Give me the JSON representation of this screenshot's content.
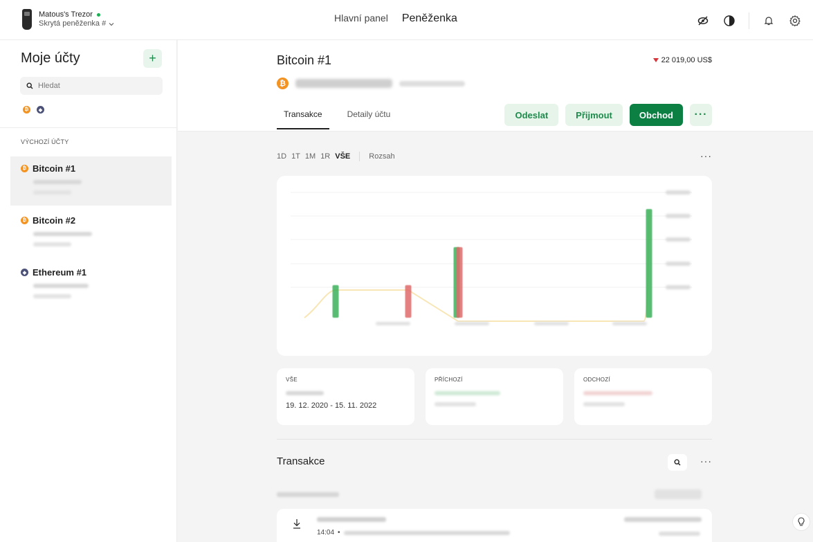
{
  "device": {
    "name": "Matous's Trezor",
    "wallet": "Skrytá peněženka #"
  },
  "nav": {
    "dashboard": "Hlavní panel",
    "wallet": "Peněženka"
  },
  "sidebar": {
    "title": "Moje účty",
    "add_label": "+",
    "search_placeholder": "Hledat",
    "section_label": "VÝCHOZÍ ÚČTY",
    "accounts": [
      {
        "name": "Bitcoin #1",
        "coin": "btc",
        "active": true
      },
      {
        "name": "Bitcoin #2",
        "coin": "btc",
        "active": false
      },
      {
        "name": "Ethereum #1",
        "coin": "eth",
        "active": false
      }
    ]
  },
  "account": {
    "title": "Bitcoin #1",
    "price_change": "22 019,00 US$",
    "price_direction": "down"
  },
  "tabs": {
    "transactions": "Transakce",
    "details": "Detaily účtu"
  },
  "actions": {
    "send": "Odeslat",
    "receive": "Přijmout",
    "trade": "Obchod",
    "more": "···"
  },
  "ranges": {
    "items": [
      "1D",
      "1T",
      "1M",
      "1R",
      "VŠE"
    ],
    "active": "VŠE",
    "custom": "Rozsah",
    "more": "···"
  },
  "chart_data": {
    "type": "bar",
    "title": "",
    "xlabel": "",
    "ylabel": "",
    "series": [
      {
        "color": "#3cb25b",
        "values": [
          0.3,
          0,
          0.65,
          0,
          0,
          1.0
        ]
      },
      {
        "color": "#e06a6a",
        "values": [
          0,
          0.3,
          0.65,
          0,
          0,
          0
        ]
      }
    ],
    "categories": [
      "",
      "",
      "",
      "",
      "",
      ""
    ],
    "line_color": "#f2d27a"
  },
  "stats": {
    "all": {
      "label": "VŠE",
      "range": "19. 12. 2020 - 15. 11. 2022"
    },
    "incoming": {
      "label": "PŘÍCHOZÍ"
    },
    "outgoing": {
      "label": "ODCHOZÍ"
    }
  },
  "transactions": {
    "title": "Transakce",
    "more": "···",
    "rows": [
      {
        "time": "14:04",
        "separator": "•"
      }
    ]
  },
  "colors": {
    "accent": "#0c7f43",
    "accent_soft": "#e6f4ea",
    "btc": "#f39322",
    "eth": "#4c5178",
    "down": "#d6353c"
  }
}
